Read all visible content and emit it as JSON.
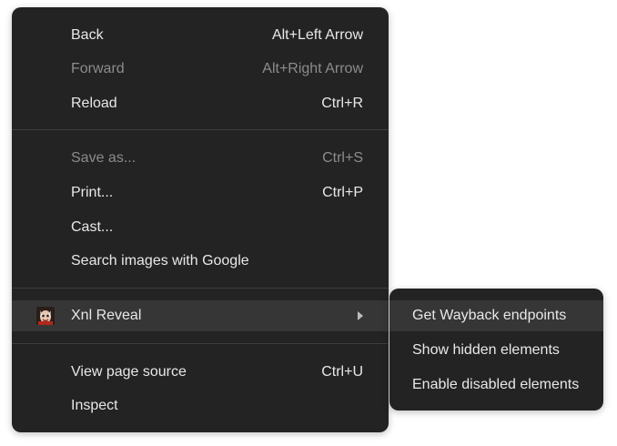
{
  "context_menu": {
    "back": {
      "label": "Back",
      "shortcut": "Alt+Left Arrow"
    },
    "forward": {
      "label": "Forward",
      "shortcut": "Alt+Right Arrow"
    },
    "reload": {
      "label": "Reload",
      "shortcut": "Ctrl+R"
    },
    "save_as": {
      "label": "Save as...",
      "shortcut": "Ctrl+S"
    },
    "print": {
      "label": "Print...",
      "shortcut": "Ctrl+P"
    },
    "cast": {
      "label": "Cast..."
    },
    "search_images": {
      "label": "Search images with Google"
    },
    "xnl_reveal": {
      "label": "Xnl Reveal",
      "icon": "xnl-reveal-extension-icon"
    },
    "view_source": {
      "label": "View page source",
      "shortcut": "Ctrl+U"
    },
    "inspect": {
      "label": "Inspect"
    }
  },
  "submenu": {
    "items": [
      {
        "label": "Get Wayback endpoints"
      },
      {
        "label": "Show hidden elements"
      },
      {
        "label": "Enable disabled elements"
      }
    ]
  },
  "colors": {
    "menu_bg": "#232323",
    "highlight_bg": "#363636",
    "text": "#e8e8e8",
    "disabled_text": "#8c8c8c",
    "separator": "#3e3e3e"
  }
}
